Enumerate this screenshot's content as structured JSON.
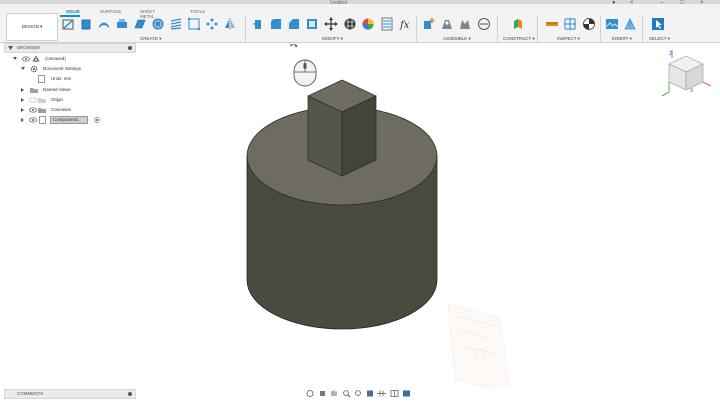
{
  "window": {
    "title": "Untitled"
  },
  "workspace": {
    "design_label": "DESIGN ▾"
  },
  "tabs": [
    {
      "label": "SOLID",
      "active": true
    },
    {
      "label": "SURFACE",
      "active": false
    },
    {
      "label": "SHEET METAL",
      "active": false
    },
    {
      "label": "TOOLS",
      "active": false
    }
  ],
  "groups": {
    "create": "CREATE ▾",
    "modify": "MODIFY ▾",
    "assemble": "ASSEMBLE ▾",
    "construct": "CONSTRUCT ▾",
    "inspect": "INSPECT ▾",
    "insert": "INSERT ▾",
    "select": "SELECT ▾"
  },
  "browser": {
    "header": "BROWSER",
    "root": "(Unsaved)",
    "items": {
      "document_settings": "Document Settings",
      "units": "Units: mm",
      "named_views": "Named Views",
      "origin": "Origin",
      "canvases": "Canvases",
      "component": "Component1"
    }
  },
  "comments": {
    "label": "COMMENTS"
  },
  "colors": {
    "accent": "#0696d7",
    "model_dark": "#4a4a3f",
    "model_top": "#6e6c60"
  }
}
